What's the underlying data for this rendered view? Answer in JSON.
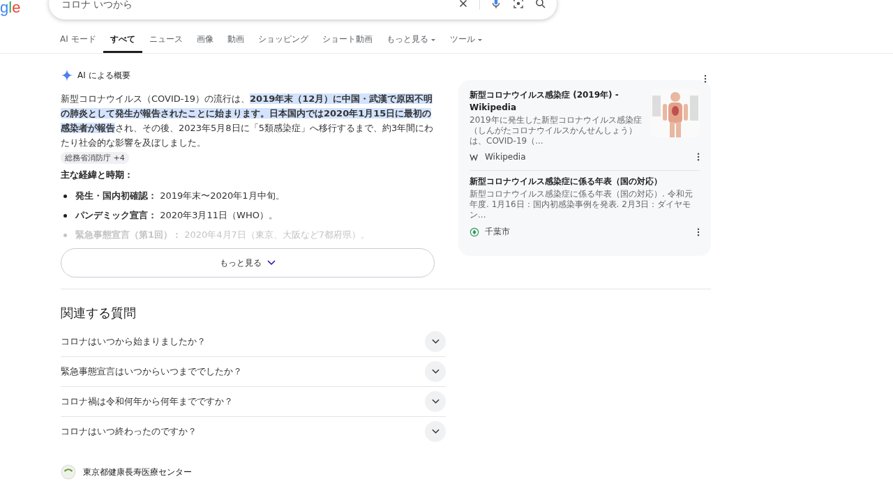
{
  "logo": "gle",
  "search": {
    "value": "コロナ いつから"
  },
  "tabs": [
    {
      "label": "AI モード",
      "selected": false,
      "dropdown": false
    },
    {
      "label": "すべて",
      "selected": true,
      "dropdown": false
    },
    {
      "label": "ニュース",
      "selected": false,
      "dropdown": false
    },
    {
      "label": "画像",
      "selected": false,
      "dropdown": false
    },
    {
      "label": "動画",
      "selected": false,
      "dropdown": false
    },
    {
      "label": "ショッピング",
      "selected": false,
      "dropdown": false
    },
    {
      "label": "ショート動画",
      "selected": false,
      "dropdown": false
    },
    {
      "label": "もっと見る",
      "selected": false,
      "dropdown": true
    },
    {
      "label": "ツール",
      "selected": false,
      "dropdown": true
    }
  ],
  "ai_overview": {
    "title": "AI による概要",
    "summary": "新型コロナウイルス（COVID-19）の流行は、**2019年末（12月）に中国・武漢で原因不明の肺炎として発生が報告されたことに始まります。日本国内では2020年1月15日に最初の感染者が報告**され、その後、2023年5月8日に「5類感染症」へ移行するまで、約3年間にわたり社会的な影響を及ぼしました。",
    "source_chip": "総務省消防庁 +4",
    "heading": "主な経緯と時期：",
    "bullets": [
      {
        "label": "発生・国内初確認：",
        "text": "2019年末〜2020年1月中旬。",
        "faded": false
      },
      {
        "label": "パンデミック宣言：",
        "text": "2020年3月11日（WHO）。",
        "faded": false
      },
      {
        "label": "緊急事態宣言（第1回）：",
        "text": "2020年4月7日（東京、大阪など7都府県）。",
        "faded": true
      }
    ],
    "more_button": "もっと見る",
    "sources": [
      {
        "title": "新型コロナウイルス感染症 (2019年) - Wikipedia",
        "snippet": "2019年に発生した新型コロナウイルス感染症（しんがたコロナウイルスかんせんしょう）は、COVID-19（...",
        "site": "Wikipedia",
        "kind": "wiki",
        "thumbnail": true
      },
      {
        "title": "新型コロナウイルス感染症に係る年表（国の対応）",
        "snippet": "新型コロナウイルス感染症に係る年表（国の対応）. 令和元年度. 1月16日：国内初感染事例を発表. 2月3日：ダイヤモン...",
        "site": "千葉市",
        "kind": "city",
        "thumbnail": false
      }
    ]
  },
  "related": {
    "title": "関連する質問",
    "questions": [
      {
        "text": "コロナはいつから始まりましたか？",
        "expanded": false
      },
      {
        "text": "緊急事態宣言はいつからいつまででしたか？",
        "expanded": false
      },
      {
        "text": "コロナ禍は令和何年から何年までですか？",
        "expanded": false
      },
      {
        "text": "コロナはいつ終わったのですか？",
        "expanded": false
      }
    ]
  },
  "next_result": {
    "site": "東京都健康長寿医療センター"
  }
}
